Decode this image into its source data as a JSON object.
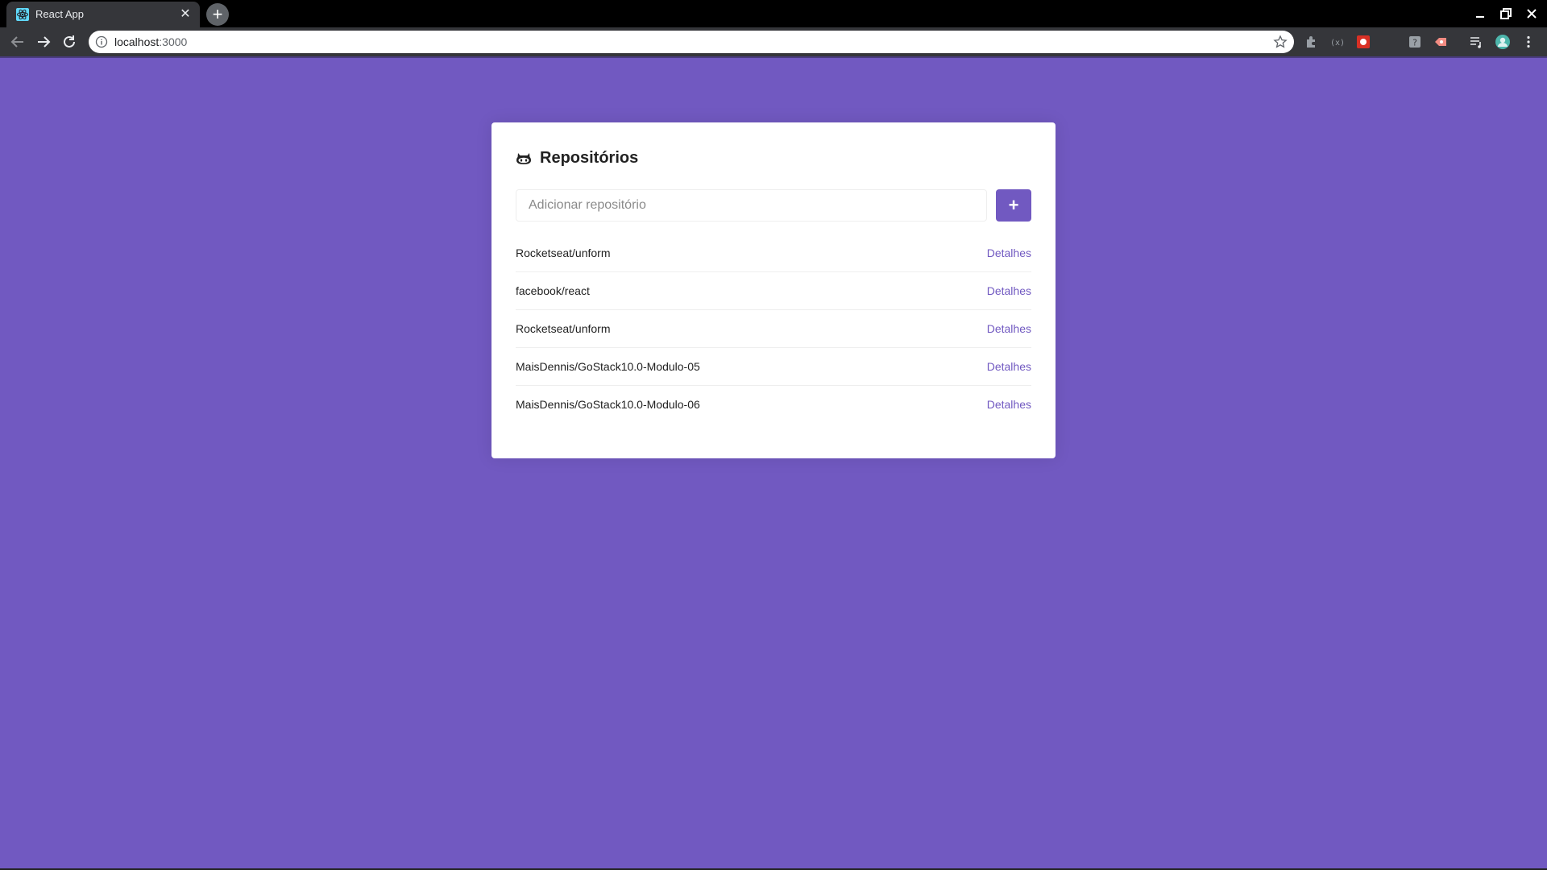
{
  "browser": {
    "tab_title": "React App",
    "tab_close": "✕",
    "new_tab": "+",
    "url_host": "localhost",
    "url_port": ":3000"
  },
  "app": {
    "title": "Repositórios",
    "input_placeholder": "Adicionar repositório",
    "add_button": "+",
    "repositories": [
      {
        "name": "Rocketseat/unform",
        "link": "Detalhes"
      },
      {
        "name": "facebook/react",
        "link": "Detalhes"
      },
      {
        "name": "Rocketseat/unform",
        "link": "Detalhes"
      },
      {
        "name": "MaisDennis/GoStack10.0-Modulo-05",
        "link": "Detalhes"
      },
      {
        "name": "MaisDennis/GoStack10.0-Modulo-06",
        "link": "Detalhes"
      }
    ]
  },
  "colors": {
    "background": "#7159c1",
    "accent": "#7159c1",
    "card": "#ffffff"
  }
}
